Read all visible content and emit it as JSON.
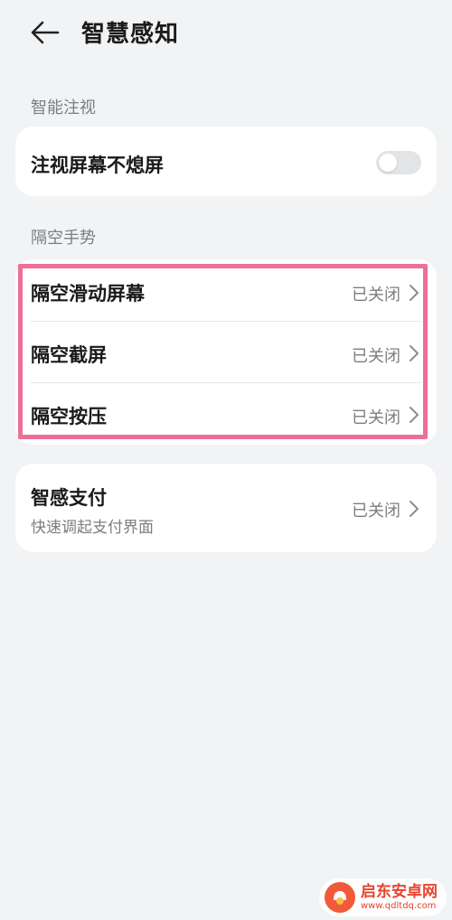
{
  "header": {
    "title": "智慧感知"
  },
  "sections": {
    "smart_gaze": {
      "label": "智能注视",
      "item_label": "注视屏幕不熄屏",
      "toggle_on": false
    },
    "air_gesture": {
      "label": "隔空手势",
      "items": [
        {
          "label": "隔空滑动屏幕",
          "value": "已关闭"
        },
        {
          "label": "隔空截屏",
          "value": "已关闭"
        },
        {
          "label": "隔空按压",
          "value": "已关闭"
        }
      ]
    },
    "smart_pay": {
      "label": "智感支付",
      "sub_label": "快速调起支付界面",
      "value": "已关闭"
    }
  },
  "colors": {
    "background": "#f1f3f5",
    "card": "#ffffff",
    "highlight": "#ee6f95",
    "secondary_text": "#7b7e82"
  },
  "watermark": {
    "title": "启东安卓网",
    "url": "www.qdltdq.com"
  }
}
